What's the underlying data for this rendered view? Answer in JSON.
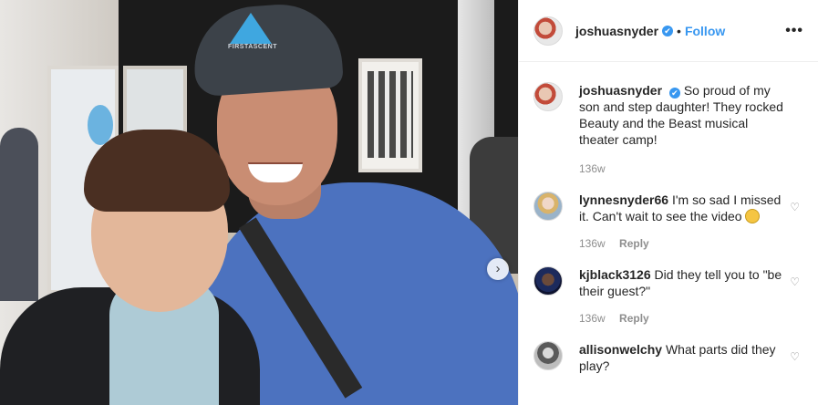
{
  "post": {
    "next_icon": "chevron-right-icon",
    "cap_text": "FIRSTASCENT"
  },
  "header": {
    "username": "joshuasnyder",
    "separator": "•",
    "follow_label": "Follow",
    "more_label": "•••"
  },
  "caption": {
    "username": "joshuasnyder",
    "text": "So proud of my son and step daughter! They rocked Beauty and the Beast musical theater camp!",
    "time": "136w"
  },
  "comments": [
    {
      "username": "lynnesnyder66",
      "text": "I'm so sad I missed it. Can't wait to see the video",
      "time": "136w",
      "reply_label": "Reply"
    },
    {
      "username": "kjblack3126",
      "text": "Did they tell you to \"be their guest?\"",
      "time": "136w",
      "reply_label": "Reply"
    },
    {
      "username": "allisonwelchy",
      "text": "What parts did they play?"
    }
  ],
  "icons": {
    "verified": "✔",
    "heart": "♡",
    "next": "›"
  },
  "colors": {
    "link": "#3897f0",
    "muted": "#8e8e8e"
  }
}
